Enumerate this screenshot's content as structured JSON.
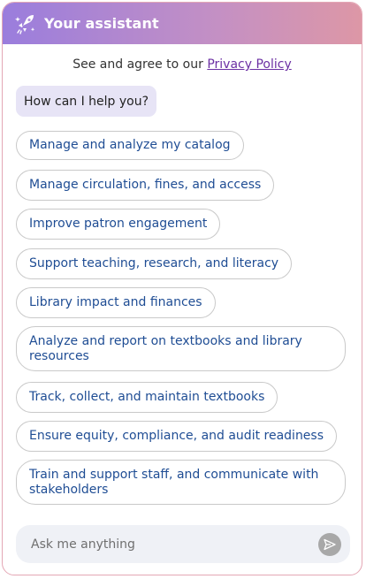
{
  "header": {
    "title": "Your assistant",
    "icon": "rocket-sparkle-icon",
    "gradient": [
      "#9a7ddd",
      "#dd97a6"
    ]
  },
  "privacy": {
    "prefix": "See and agree to our ",
    "link_label": "Privacy Policy"
  },
  "greeting": "How can I help you?",
  "suggestions": [
    "Manage and analyze my catalog",
    "Manage circulation, fines, and access",
    "Improve patron engagement",
    "Support teaching, research, and literacy",
    "Library impact and finances",
    "Analyze and report on textbooks and library resources",
    "Track, collect, and maintain textbooks",
    "Ensure equity, compliance, and audit readiness",
    "Train and support staff, and communicate with stakeholders"
  ],
  "input": {
    "placeholder": "Ask me anything",
    "send_icon": "send-icon"
  }
}
